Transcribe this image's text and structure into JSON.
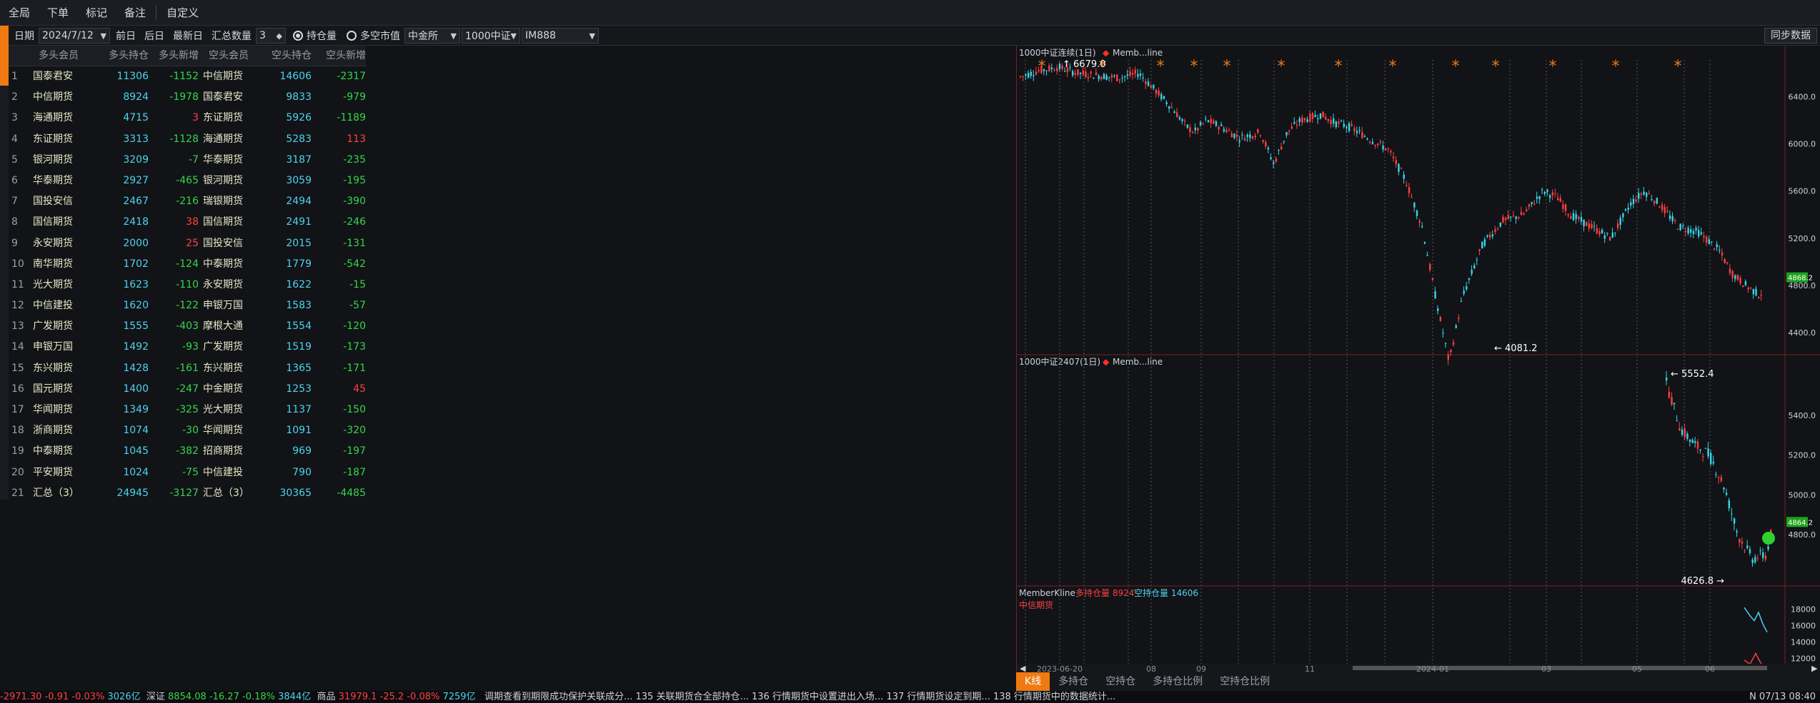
{
  "menubar": {
    "items": [
      "全局",
      "下单",
      "标记",
      "备注",
      "自定义"
    ]
  },
  "toolbar": {
    "date_label": "日期",
    "date_value": "2024/7/12",
    "prev_day": "前日",
    "next_day": "后日",
    "latest_day": "最新日",
    "summary_label": "汇总数量",
    "summary_value": "3",
    "radio_oi": "持仓量",
    "radio_mv": "多空市值",
    "exchange": "中金所",
    "product": "1000中证",
    "contract": "IM888",
    "sync_button": "同步数据"
  },
  "table": {
    "headers": [
      "",
      "多头会员",
      "多头持仓",
      "多头新增",
      "空头会员",
      "空头持仓",
      "空头新增"
    ],
    "rows": [
      [
        "1",
        "国泰君安",
        "11306",
        "-1152",
        "中信期货",
        "14606",
        "-2317"
      ],
      [
        "2",
        "中信期货",
        "8924",
        "-1978",
        "国泰君安",
        "9833",
        "-979"
      ],
      [
        "3",
        "海通期货",
        "4715",
        "3",
        "东证期货",
        "5926",
        "-1189"
      ],
      [
        "4",
        "东证期货",
        "3313",
        "-1128",
        "海通期货",
        "5283",
        "113"
      ],
      [
        "5",
        "银河期货",
        "3209",
        "-7",
        "华泰期货",
        "3187",
        "-235"
      ],
      [
        "6",
        "华泰期货",
        "2927",
        "-465",
        "银河期货",
        "3059",
        "-195"
      ],
      [
        "7",
        "国投安信",
        "2467",
        "-216",
        "瑞银期货",
        "2494",
        "-390"
      ],
      [
        "8",
        "国信期货",
        "2418",
        "38",
        "国信期货",
        "2491",
        "-246"
      ],
      [
        "9",
        "永安期货",
        "2000",
        "25",
        "国投安信",
        "2015",
        "-131"
      ],
      [
        "10",
        "南华期货",
        "1702",
        "-124",
        "中泰期货",
        "1779",
        "-542"
      ],
      [
        "11",
        "光大期货",
        "1623",
        "-110",
        "永安期货",
        "1622",
        "-15"
      ],
      [
        "12",
        "中信建投",
        "1620",
        "-122",
        "申银万国",
        "1583",
        "-57"
      ],
      [
        "13",
        "广发期货",
        "1555",
        "-403",
        "摩根大通",
        "1554",
        "-120"
      ],
      [
        "14",
        "申银万国",
        "1492",
        "-93",
        "广发期货",
        "1519",
        "-173"
      ],
      [
        "15",
        "东兴期货",
        "1428",
        "-161",
        "东兴期货",
        "1365",
        "-171"
      ],
      [
        "16",
        "国元期货",
        "1400",
        "-247",
        "中金期货",
        "1253",
        "45"
      ],
      [
        "17",
        "华闻期货",
        "1349",
        "-325",
        "光大期货",
        "1137",
        "-150"
      ],
      [
        "18",
        "浙商期货",
        "1074",
        "-30",
        "华闻期货",
        "1091",
        "-320"
      ],
      [
        "19",
        "中泰期货",
        "1045",
        "-382",
        "招商期货",
        "969",
        "-197"
      ],
      [
        "20",
        "平安期货",
        "1024",
        "-75",
        "中信建投",
        "790",
        "-187"
      ],
      [
        "21",
        "汇总（3）",
        "24945",
        "-3127",
        "汇总（3）",
        "30365",
        "-4485"
      ]
    ]
  },
  "chart_top": {
    "title": "1000中证连续(1日)",
    "legend": "Memb...line",
    "high_label": "6679.0",
    "low_label": "4081.2",
    "y_ticks": [
      "6400.0",
      "6000.0",
      "5600.0",
      "5200.0",
      "4800.0",
      "4400.0"
    ],
    "last_value": "4868.2"
  },
  "chart_mid": {
    "title": "1000中证2407(1日)",
    "legend": "Memb...line",
    "high_label": "5552.4",
    "low_label": "4626.8",
    "y_ticks": [
      "5400.0",
      "5200.0",
      "5000.0",
      "4800.0"
    ],
    "last_value": "4864.2"
  },
  "chart_bottom": {
    "title": "MemberKline",
    "long_label": "多持仓量 8924",
    "short_label": "空持仓量 14606",
    "member": "中信期货",
    "y_ticks": [
      "18000",
      "16000",
      "14000",
      "12000"
    ]
  },
  "x_axis": {
    "labels": [
      "2023-06-20",
      "08",
      "09",
      "11",
      "2024-01",
      "03",
      "05",
      "06"
    ]
  },
  "bottom_tabs": [
    "K线",
    "多持仓",
    "空持仓",
    "多持仓比例",
    "空持仓比例"
  ],
  "status_bar": {
    "s1": "-2971.30",
    "s2": "-0.91",
    "s3": "-0.03%",
    "s4": "3026亿",
    "s5": "深证",
    "s6": "8854.08",
    "s7": "-16.27",
    "s8": "-0.18%",
    "s9": "3844亿",
    "s10": "商品",
    "s11": "31979.1",
    "s12": "-25.2",
    "s13": "-0.08%",
    "s14": "7259亿",
    "s15": "调期查看到期限成功保护关联成分...   135 关联期货合全部持仓...   136 行情期货中设置进出入场...   137 行情期货设定到期...   138 行情期货中的数据统计...",
    "s16": "N 07/13 08:40"
  },
  "colors": {
    "accent": "#f07a12",
    "up": "#ff4040",
    "down": "#35d64a",
    "cyan": "#4fd3ec"
  }
}
